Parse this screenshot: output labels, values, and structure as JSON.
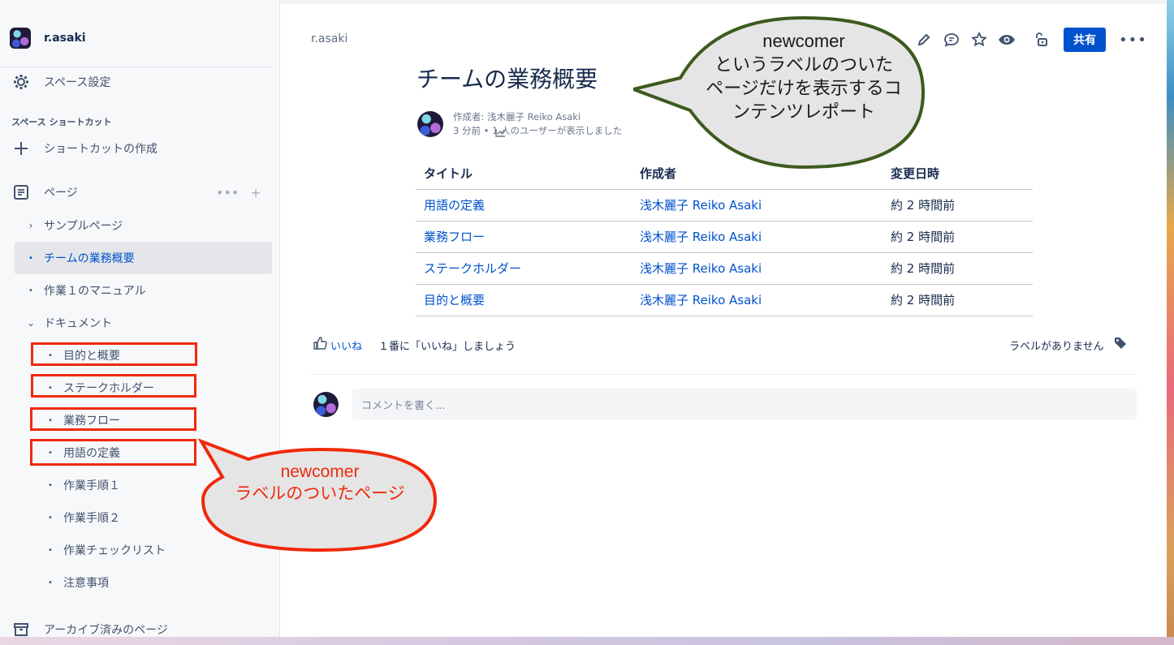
{
  "sidebar": {
    "space_name": "r.asaki",
    "settings_label": "スペース設定",
    "shortcut_section": "スペース ショートカット",
    "create_shortcut": "ショートカットの作成",
    "pages_label": "ページ",
    "archive_label": "アーカイブ済みのページ",
    "tree": [
      {
        "label": "サンプルページ"
      },
      {
        "label": "チームの業務概要"
      },
      {
        "label": "作業１のマニュアル"
      },
      {
        "label": "ドキュメント"
      },
      {
        "label": "目的と概要"
      },
      {
        "label": "ステークホルダー"
      },
      {
        "label": "業務フロー"
      },
      {
        "label": "用語の定義"
      },
      {
        "label": "作業手順１"
      },
      {
        "label": "作業手順２"
      },
      {
        "label": "作業チェックリスト"
      },
      {
        "label": "注意事項"
      }
    ]
  },
  "header": {
    "breadcrumb": "r.asaki",
    "share_label": "共有",
    "more_label": "•••"
  },
  "page": {
    "title": "チームの業務概要",
    "author_line": "作成者: 浅木麗子 Reiko Asaki",
    "meta_line": "3 分前 •  1 人のユーザーが表示しました"
  },
  "report": {
    "headers": [
      "タイトル",
      "作成者",
      "変更日時"
    ],
    "rows": [
      [
        "用語の定義",
        "浅木麗子 Reiko Asaki",
        "約 2 時間前"
      ],
      [
        "業務フロー",
        "浅木麗子 Reiko Asaki",
        "約 2 時間前"
      ],
      [
        "ステークホルダー",
        "浅木麗子 Reiko Asaki",
        "約 2 時間前"
      ],
      [
        "目的と概要",
        "浅木麗子 Reiko Asaki",
        "約 2 時間前"
      ]
    ]
  },
  "footer": {
    "like_label": "いいね",
    "like_message": "１番に「いいね」しましょう",
    "no_labels": "ラベルがありません",
    "comment_placeholder": "コメントを書く..."
  },
  "callouts": {
    "top": [
      "newcomer",
      "というラベルのついた",
      "ページだけを表示するコ",
      "ンテンツレポート"
    ],
    "bottom": [
      "newcomer",
      "ラベルのついたページ"
    ]
  },
  "colors": {
    "accent": "#0052cc",
    "highlight_red": "#f0290c",
    "callout_green_border": "#3d5a1e",
    "callout_fill": "#e5e5e5"
  },
  "icons": [
    "gear-icon",
    "plus-icon",
    "page-icon",
    "more-icon",
    "chevron-right-icon",
    "chevron-down-icon",
    "archive-icon",
    "edit-icon",
    "comment-icon",
    "star-icon",
    "watch-icon",
    "restrictions-icon",
    "analytics-icon",
    "like-icon",
    "label-icon"
  ]
}
